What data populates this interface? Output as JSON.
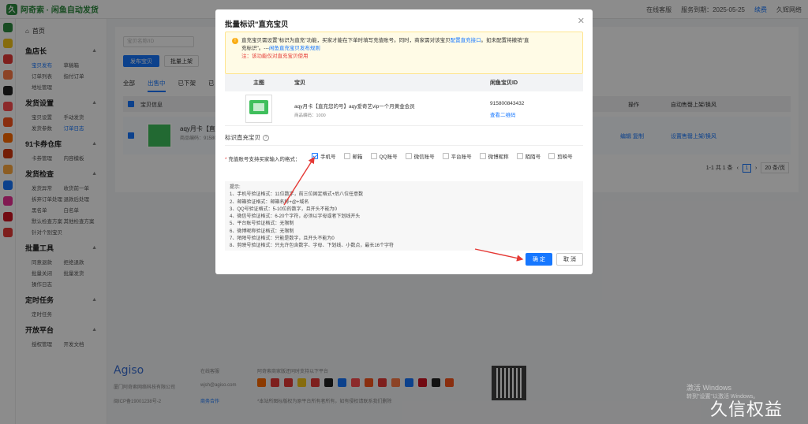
{
  "app": {
    "brand": "阿奇索 · 闲鱼自动发货"
  },
  "topbar": {
    "support": "在线客服",
    "service_date": "服务到期：2025-05-25",
    "renew": "续费",
    "user": "久辉网络"
  },
  "sidebar": {
    "home": "首页",
    "groups": [
      {
        "title": "鱼店长",
        "items": [
          "宝贝发布",
          "草稿箱",
          "订单列表",
          "指付订单",
          "地址管理"
        ],
        "active": "宝贝发布"
      },
      {
        "title": "发货设置",
        "items": [
          "宝贝设置",
          "手动发货",
          "发货参数",
          "订单日志"
        ],
        "active": "订单日志"
      },
      {
        "title": "91卡券仓库",
        "items": [
          "卡券管理",
          "内容模板"
        ]
      },
      {
        "title": "发货检查",
        "items": [
          "发货异常",
          "收货前一单",
          "拆弃订单处理",
          "退款后处理",
          "黑名单",
          "白名单",
          "默认检查方案",
          "其他检查方案",
          "针对个别宝贝"
        ]
      },
      {
        "title": "批量工具",
        "items": [
          "同意退款",
          "拒绝退款",
          "批量关闭",
          "批量发货",
          "操作日志"
        ]
      },
      {
        "title": "定时任务",
        "items": [
          "定时任务"
        ]
      },
      {
        "title": "开放平台",
        "items": [
          "授权管理",
          "开发文档"
        ]
      }
    ]
  },
  "main": {
    "search_placeholder": "宝贝名称/ID",
    "publish_button": "发布宝贝",
    "batch_up_button": "批量上架",
    "tabs": [
      "全部",
      "出售中",
      "已下架",
      "已"
    ],
    "active_tab": "出售中",
    "columns": {
      "item_info": "宝贝信息",
      "ops": "操作",
      "auto": "自动售罄上架/换风"
    },
    "row": {
      "title": "aqy月卡【直",
      "code": "商品编码：91580",
      "ops": "编辑  复制",
      "auto": "设置售罄上架/换风"
    },
    "pager": {
      "total": "1-1 共 1 条",
      "page": "1",
      "page_size": "20 条/页"
    }
  },
  "footer": {
    "brand": "Agiso",
    "company": "厦门阿奇索网络科技有限公司",
    "icp": "闽ICP备19001238号-2",
    "contact_label": "在线客服",
    "email": "wjsh@agiso.com",
    "partner": "商务合作",
    "platforms": "阿奇索商家版还同时支持以下平台",
    "disclaimer": "*本站所图标版权为原平台所有者所有，如有侵权请联系我们删除"
  },
  "modal": {
    "title": "批量标识\"直充宝贝",
    "notice_line1": "直充宝贝需设置\"标识为直充\"功能，买家才能在下单时填写充值账号。同时，商家需对该宝贝",
    "notice_link1": "配置直充接口",
    "notice_line1b": "。如未配置将撤销\"直",
    "notice_line2": "充标识\"。---",
    "notice_link2": "闲鱼直充宝贝发布规则",
    "notice_red": "注：该功能仅对直充宝贝使用",
    "table_headers": {
      "image": "主图",
      "item": "宝贝",
      "id": "闲鱼宝贝ID"
    },
    "item": {
      "title": "aqy月卡【直充您的号】aqy爱奇艺vip一个月黄金会员",
      "code": "商品编码：1000",
      "id": "915800843432",
      "qr_link": "查看二维码"
    },
    "section_label": "标识直充宝贝",
    "format_label": "充值账号支持买家输入的格式：",
    "options": [
      {
        "label": "手机号",
        "checked": true
      },
      {
        "label": "邮箱",
        "checked": false
      },
      {
        "label": "QQ账号",
        "checked": false
      },
      {
        "label": "微信账号",
        "checked": false
      },
      {
        "label": "平台账号",
        "checked": false
      },
      {
        "label": "微博昵称",
        "checked": false
      },
      {
        "label": "陌陌号",
        "checked": false
      },
      {
        "label": "剪映号",
        "checked": false
      }
    ],
    "tips": [
      "提示:",
      "1、手机号验证格式：11位数字，前三位固定格式+后八位任意数",
      "2、邮箱验证格式：邮箱名称+@+域名",
      "3、QQ号验证格式：5-10位的数字，且开头不能为0",
      "4、微信号验证格式：6-20个字符，必须以字母或者下划线开头",
      "5、平台账号验证格式：无限制",
      "6、微博昵称验证格式：无限制",
      "7、陌陌号验证格式：只能是数字，且开头不能为0",
      "8、剪映号验证格式：只允许包含数字、字母、下划线、小数点，最长16个字符"
    ],
    "ok_button": "确 定",
    "cancel_button": "取 消"
  },
  "watermarks": {
    "windows": "激活 Windows",
    "windows_sub": "转到\"设置\"以激活 Windows。",
    "corner": "久信权益"
  },
  "colors": {
    "primary": "#1677ff",
    "brand_green": "#2d8a3e",
    "warning_bg": "#fffbe6",
    "warning_border": "#ffe58f",
    "danger": "#e53935",
    "annotation_red": "#e53935"
  }
}
